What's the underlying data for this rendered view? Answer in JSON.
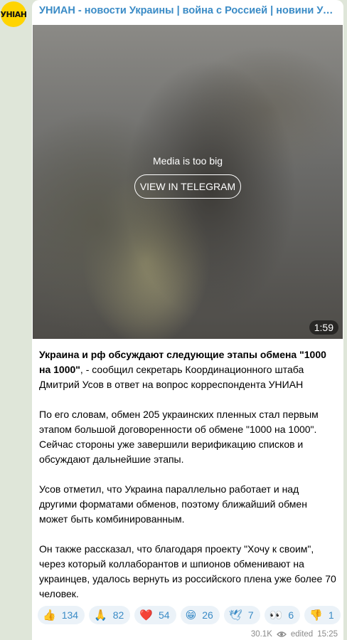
{
  "channel": {
    "avatar_text": "УНІАН",
    "title": "УНИАН - новости Украины | война с Россией | новини України"
  },
  "media": {
    "message": "Media is too big",
    "button_label": "VIEW IN TELEGRAM",
    "duration": "1:59"
  },
  "post": {
    "p1_bold": "Украина и рф обсуждают следующие этапы обмена \"1000 на 1000\"",
    "p1_rest": ", - сообщил секретарь Координационного штаба Дмитрий Усов в ответ на вопрос корреспондента УНИАН",
    "p2": "По его словам, обмен 205 украинских пленных стал первым этапом большой договоренности об обмене \"1000 на 1000\". Сейчас стороны уже завершили верификацию списков и обсуждают дальнейшие этапы.",
    "p3": "Усов отметил, что Украина параллельно работает и над другими форматами обменов, поэтому ближайший обмен может быть комбинированным.",
    "p4": "Он также рассказал, что благодаря проекту \"Хочу к своим\", через который коллаборантов и шпионов обменивают на украинцев, удалось вернуть из российского плена уже более 70 человек."
  },
  "reactions": [
    {
      "emoji": "👍",
      "count": "134",
      "icon": "thumbs-up-icon"
    },
    {
      "emoji": "🙏",
      "count": "82",
      "icon": "praying-hands-icon"
    },
    {
      "emoji": "❤️",
      "count": "54",
      "icon": "heart-icon"
    },
    {
      "emoji": "😁",
      "count": "26",
      "icon": "grin-icon"
    },
    {
      "emoji": "🕊",
      "count": "7",
      "icon": "dove-icon"
    },
    {
      "emoji": "👀",
      "count": "6",
      "icon": "eyes-icon"
    },
    {
      "emoji": "👎",
      "count": "1",
      "icon": "thumbs-down-icon"
    }
  ],
  "meta": {
    "views": "30.1K",
    "edited_label": "edited",
    "time": "15:25"
  },
  "colors": {
    "accent": "#3a8bc6",
    "avatar_bg": "#ffd400",
    "page_bg": "#dfe6d9"
  }
}
